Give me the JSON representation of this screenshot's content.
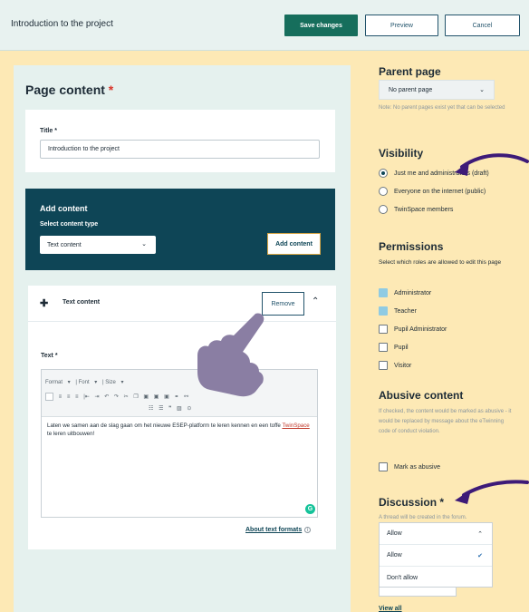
{
  "topbar": {
    "title": "Introduction to the project",
    "save_label": "Save changes",
    "preview_label": "Preview",
    "cancel_label": "Cancel"
  },
  "left": {
    "heading": "Page content",
    "required_mark": "*",
    "title_field": {
      "label": "Title *",
      "value": "Introduction to the project"
    },
    "add_content": {
      "heading": "Add content",
      "select_label": "Select content type",
      "select_value": "Text content",
      "button_label": "Add content"
    },
    "text_block": {
      "name": "Text content",
      "remove_label": "Remove",
      "text_label": "Text *",
      "toolbar": {
        "format": "Format",
        "font": "Font",
        "size": "Size"
      },
      "content_before": "Laten we samen aan de slag gaan om het nieuwe ESEP-platform te leren kennen en een toffe ",
      "content_spell": "TwinSpace",
      "content_after": " te leren uitbouwen!",
      "about_link": "About text formats"
    }
  },
  "right": {
    "parent_page": {
      "heading": "Parent page",
      "select_value": "No parent page",
      "note": "Note: No parent pages exist yet that can be selected"
    },
    "visibility": {
      "heading": "Visibility",
      "options": [
        {
          "label": "Just me and administrators (draft)",
          "selected": true
        },
        {
          "label": "Everyone on the internet (public)",
          "selected": false
        },
        {
          "label": "TwinSpace members",
          "selected": false
        }
      ]
    },
    "permissions": {
      "heading": "Permissions",
      "description": "Select which roles are allowed to edit this page",
      "roles": [
        {
          "label": "Administrator",
          "checked": true
        },
        {
          "label": "Teacher",
          "checked": true
        },
        {
          "label": "Pupil Administrator",
          "checked": false
        },
        {
          "label": "Pupil",
          "checked": false
        },
        {
          "label": "Visitor",
          "checked": false
        }
      ]
    },
    "abusive": {
      "heading": "Abusive content",
      "note": "If checked, the content would be marked as abusive - it would be replaced by message about the eTwinning code of conduct violation.",
      "checkbox_label": "Mark as abusive"
    },
    "discussion": {
      "heading": "Discussion *",
      "note": "A thread will be created in the forum.",
      "options": [
        "Allow",
        "Allow",
        "Don't allow"
      ],
      "view_all": "View all"
    }
  },
  "colors": {
    "background": "#fde9b5",
    "primary": "#166e5c",
    "dark_teal": "#0e4556",
    "arrow": "#3d1a78",
    "hand": "#8a7ea3"
  }
}
